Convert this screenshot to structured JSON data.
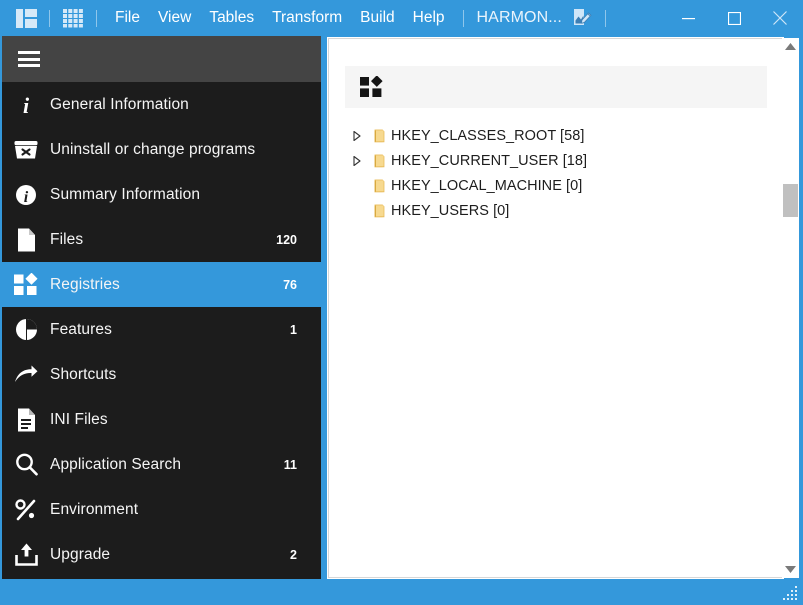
{
  "window": {
    "accent_color": "#3498db",
    "sidebar_color": "#1c1c1c",
    "title": "HARMON..."
  },
  "titlebar": {
    "app_icon": "dashboard-layout-icon",
    "grid_icon": "grid-icon",
    "menus": [
      {
        "label": "File"
      },
      {
        "label": "View"
      },
      {
        "label": "Tables"
      },
      {
        "label": "Transform"
      },
      {
        "label": "Build"
      },
      {
        "label": "Help"
      }
    ],
    "document_name": "HARMON...",
    "document_edit_icon": "edit-document-icon",
    "controls": {
      "minimize": "minimize-icon",
      "maximize": "maximize-icon",
      "close": "close-icon"
    }
  },
  "sidebar": {
    "menu_toggle": "hamburger-icon",
    "items": [
      {
        "label": "General Information",
        "count": "",
        "icon": "info-italic-icon",
        "selected": false
      },
      {
        "label": "Uninstall or change programs",
        "count": "",
        "icon": "uninstall-box-icon",
        "selected": false
      },
      {
        "label": "Summary Information",
        "count": "",
        "icon": "info-circle-icon",
        "selected": false
      },
      {
        "label": "Files",
        "count": "120",
        "icon": "file-page-icon",
        "selected": false
      },
      {
        "label": "Registries",
        "count": "76",
        "icon": "registries-blocks-icon",
        "selected": true
      },
      {
        "label": "Features",
        "count": "1",
        "icon": "pie-chart-icon",
        "selected": false
      },
      {
        "label": "Shortcuts",
        "count": "",
        "icon": "arrow-shortcut-icon",
        "selected": false
      },
      {
        "label": "INI Files",
        "count": "",
        "icon": "ini-document-icon",
        "selected": false
      },
      {
        "label": "Application Search",
        "count": "11",
        "icon": "search-icon",
        "selected": false
      },
      {
        "label": "Environment",
        "count": "",
        "icon": "percent-icon",
        "selected": false
      },
      {
        "label": "Upgrade",
        "count": "2",
        "icon": "upload-icon",
        "selected": false
      }
    ]
  },
  "content": {
    "toolbar": {
      "registries_button": "registries-blocks-icon"
    },
    "tree": [
      {
        "label": "HKEY_CLASSES_ROOT [58]",
        "expandable": true,
        "expanded": false,
        "icon": "folder-icon"
      },
      {
        "label": "HKEY_CURRENT_USER [18]",
        "expandable": true,
        "expanded": false,
        "icon": "folder-icon"
      },
      {
        "label": "HKEY_LOCAL_MACHINE [0]",
        "expandable": false,
        "expanded": false,
        "icon": "folder-icon"
      },
      {
        "label": "HKEY_USERS [0]",
        "expandable": false,
        "expanded": false,
        "icon": "folder-icon"
      }
    ]
  },
  "scrollbar": {
    "up_arrow": "scroll-up-icon",
    "down_arrow": "scroll-down-icon",
    "thumb": "scroll-thumb"
  },
  "statusbar": {
    "text": "",
    "resize_grip": "resize-grip-icon"
  }
}
